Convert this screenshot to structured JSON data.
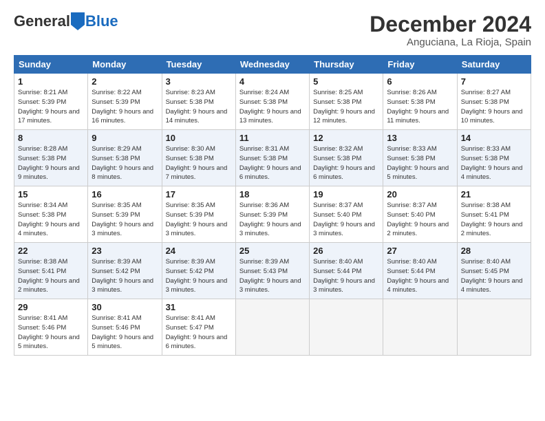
{
  "logo": {
    "general": "General",
    "blue": "Blue"
  },
  "title": "December 2024",
  "location": "Anguciana, La Rioja, Spain",
  "headers": [
    "Sunday",
    "Monday",
    "Tuesday",
    "Wednesday",
    "Thursday",
    "Friday",
    "Saturday"
  ],
  "weeks": [
    [
      {
        "day": "1",
        "sunrise": "8:21 AM",
        "sunset": "5:39 PM",
        "daylight": "9 hours and 17 minutes."
      },
      {
        "day": "2",
        "sunrise": "8:22 AM",
        "sunset": "5:39 PM",
        "daylight": "9 hours and 16 minutes."
      },
      {
        "day": "3",
        "sunrise": "8:23 AM",
        "sunset": "5:38 PM",
        "daylight": "9 hours and 14 minutes."
      },
      {
        "day": "4",
        "sunrise": "8:24 AM",
        "sunset": "5:38 PM",
        "daylight": "9 hours and 13 minutes."
      },
      {
        "day": "5",
        "sunrise": "8:25 AM",
        "sunset": "5:38 PM",
        "daylight": "9 hours and 12 minutes."
      },
      {
        "day": "6",
        "sunrise": "8:26 AM",
        "sunset": "5:38 PM",
        "daylight": "9 hours and 11 minutes."
      },
      {
        "day": "7",
        "sunrise": "8:27 AM",
        "sunset": "5:38 PM",
        "daylight": "9 hours and 10 minutes."
      }
    ],
    [
      {
        "day": "8",
        "sunrise": "8:28 AM",
        "sunset": "5:38 PM",
        "daylight": "9 hours and 9 minutes."
      },
      {
        "day": "9",
        "sunrise": "8:29 AM",
        "sunset": "5:38 PM",
        "daylight": "9 hours and 8 minutes."
      },
      {
        "day": "10",
        "sunrise": "8:30 AM",
        "sunset": "5:38 PM",
        "daylight": "9 hours and 7 minutes."
      },
      {
        "day": "11",
        "sunrise": "8:31 AM",
        "sunset": "5:38 PM",
        "daylight": "9 hours and 6 minutes."
      },
      {
        "day": "12",
        "sunrise": "8:32 AM",
        "sunset": "5:38 PM",
        "daylight": "9 hours and 6 minutes."
      },
      {
        "day": "13",
        "sunrise": "8:33 AM",
        "sunset": "5:38 PM",
        "daylight": "9 hours and 5 minutes."
      },
      {
        "day": "14",
        "sunrise": "8:33 AM",
        "sunset": "5:38 PM",
        "daylight": "9 hours and 4 minutes."
      }
    ],
    [
      {
        "day": "15",
        "sunrise": "8:34 AM",
        "sunset": "5:38 PM",
        "daylight": "9 hours and 4 minutes."
      },
      {
        "day": "16",
        "sunrise": "8:35 AM",
        "sunset": "5:39 PM",
        "daylight": "9 hours and 3 minutes."
      },
      {
        "day": "17",
        "sunrise": "8:35 AM",
        "sunset": "5:39 PM",
        "daylight": "9 hours and 3 minutes."
      },
      {
        "day": "18",
        "sunrise": "8:36 AM",
        "sunset": "5:39 PM",
        "daylight": "9 hours and 3 minutes."
      },
      {
        "day": "19",
        "sunrise": "8:37 AM",
        "sunset": "5:40 PM",
        "daylight": "9 hours and 3 minutes."
      },
      {
        "day": "20",
        "sunrise": "8:37 AM",
        "sunset": "5:40 PM",
        "daylight": "9 hours and 2 minutes."
      },
      {
        "day": "21",
        "sunrise": "8:38 AM",
        "sunset": "5:41 PM",
        "daylight": "9 hours and 2 minutes."
      }
    ],
    [
      {
        "day": "22",
        "sunrise": "8:38 AM",
        "sunset": "5:41 PM",
        "daylight": "9 hours and 2 minutes."
      },
      {
        "day": "23",
        "sunrise": "8:39 AM",
        "sunset": "5:42 PM",
        "daylight": "9 hours and 3 minutes."
      },
      {
        "day": "24",
        "sunrise": "8:39 AM",
        "sunset": "5:42 PM",
        "daylight": "9 hours and 3 minutes."
      },
      {
        "day": "25",
        "sunrise": "8:39 AM",
        "sunset": "5:43 PM",
        "daylight": "9 hours and 3 minutes."
      },
      {
        "day": "26",
        "sunrise": "8:40 AM",
        "sunset": "5:44 PM",
        "daylight": "9 hours and 3 minutes."
      },
      {
        "day": "27",
        "sunrise": "8:40 AM",
        "sunset": "5:44 PM",
        "daylight": "9 hours and 4 minutes."
      },
      {
        "day": "28",
        "sunrise": "8:40 AM",
        "sunset": "5:45 PM",
        "daylight": "9 hours and 4 minutes."
      }
    ],
    [
      {
        "day": "29",
        "sunrise": "8:41 AM",
        "sunset": "5:46 PM",
        "daylight": "9 hours and 5 minutes."
      },
      {
        "day": "30",
        "sunrise": "8:41 AM",
        "sunset": "5:46 PM",
        "daylight": "9 hours and 5 minutes."
      },
      {
        "day": "31",
        "sunrise": "8:41 AM",
        "sunset": "5:47 PM",
        "daylight": "9 hours and 6 minutes."
      },
      null,
      null,
      null,
      null
    ]
  ],
  "labels": {
    "sunrise": "Sunrise:",
    "sunset": "Sunset:",
    "daylight": "Daylight:"
  }
}
